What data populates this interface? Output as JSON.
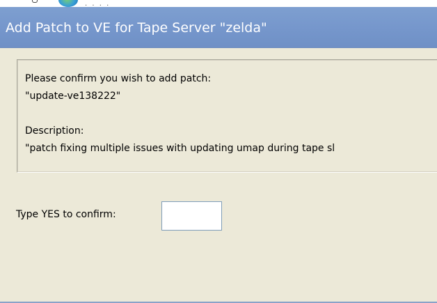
{
  "dialog": {
    "title": "Add Patch to VE for Tape Server \"zelda\"",
    "message": {
      "line1": "Please confirm you wish to add patch:",
      "line2": "\"update-ve138222\"",
      "line3": "Description:",
      "line4": "\"patch fixing multiple issues with updating umap during tape sl"
    },
    "confirm": {
      "label": "Type YES to confirm:",
      "value": "",
      "placeholder": ""
    }
  },
  "background": {
    "icon": "globe-icon"
  },
  "colors": {
    "titlebar": "#7697cc",
    "dialog_bg": "#ece9d8",
    "input_border": "#7f9db9"
  }
}
